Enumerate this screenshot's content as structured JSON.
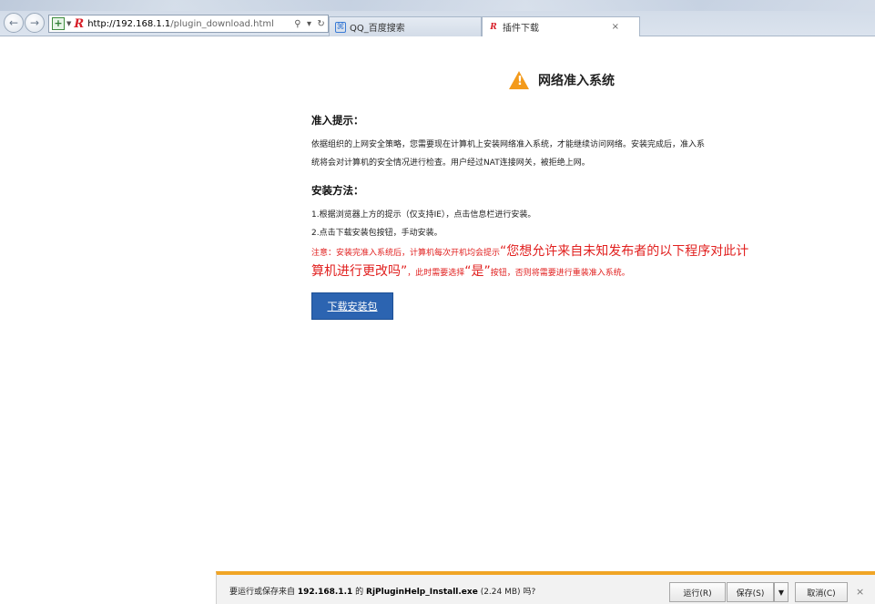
{
  "browser": {
    "url_host": "http://192.168.1.1",
    "url_path": "/plugin_download.html",
    "search_icon": "search-icon",
    "refresh_icon": "refresh-icon",
    "tabs": [
      {
        "label": "QQ_百度搜索",
        "icon": "qq-search-icon"
      },
      {
        "label": "插件下载",
        "icon": "r-logo-icon",
        "close": "×"
      }
    ]
  },
  "page": {
    "title": "网络准入系统",
    "notice_heading": "准入提示：",
    "notice_line1": "依据组织的上网安全策略，您需要现在计算机上安装网络准入系统，才能继续访问网络。安装完成后，准入系",
    "notice_line2": "统将会对计算机的安全情况进行检查。用户经过NAT连接网关，被拒绝上网。",
    "method_heading": "安装方法：",
    "step1": "1.根据浏览器上方的提示（仅支持IE），点击信息栏进行安装。",
    "step2": "2.点击下载安装包按钮，手动安装。",
    "note_prefix": "注意：安装完准入系统后，计算机每次开机均会提示",
    "note_big1": "“您想允许来自未知发布者的以下程序对此计",
    "note_big2": "算机进行更改吗”",
    "note_mid": "，此时需要选择",
    "note_yes": "“是”",
    "note_suffix": "按钮，否则将需要进行重装准入系统。",
    "download_button": "下载安装包"
  },
  "notification": {
    "msg_prefix": "要运行或保存来自",
    "host": "192.168.1.1",
    "msg_mid": "的",
    "filename": "RjPluginHelp_Install.exe",
    "size": "(2.24 MB)",
    "msg_suffix": "吗?",
    "run": "运行(R)",
    "save": "保存(S)",
    "cancel": "取消(C)",
    "close": "×"
  }
}
